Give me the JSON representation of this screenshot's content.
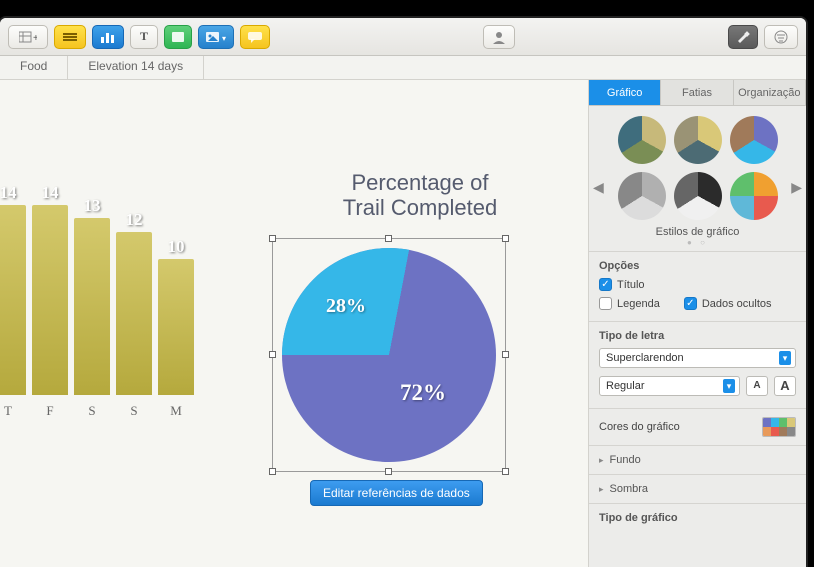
{
  "toolbar": {
    "add": "+",
    "text": "T"
  },
  "sheets": [
    "Food",
    "Elevation 14 days"
  ],
  "canvas": {
    "pie_title_line1": "Percentage of",
    "pie_title_line2": "Trail Completed",
    "edit_button": "Editar referências de dados"
  },
  "chart_data": [
    {
      "type": "bar",
      "categories": [
        "T",
        "F",
        "S",
        "S",
        "M"
      ],
      "values": [
        14,
        14,
        13,
        12,
        10
      ]
    },
    {
      "type": "pie",
      "title": "Percentage of Trail Completed",
      "series": [
        {
          "name": "",
          "value": 28,
          "label": "28%"
        },
        {
          "name": "",
          "value": 72,
          "label": "72%"
        }
      ]
    }
  ],
  "inspector": {
    "tabs": [
      "Gráfico",
      "Fatias",
      "Organização"
    ],
    "styles_label": "Estilos de gráfico",
    "options": {
      "heading": "Opções",
      "title": "Título",
      "legend": "Legenda",
      "hidden_data": "Dados ocultos"
    },
    "font": {
      "heading": "Tipo de letra",
      "family": "Superclarendon",
      "weight": "Regular"
    },
    "colors_heading": "Cores do gráfico",
    "background": "Fundo",
    "shadow": "Sombra",
    "chart_type": "Tipo de gráfico"
  }
}
